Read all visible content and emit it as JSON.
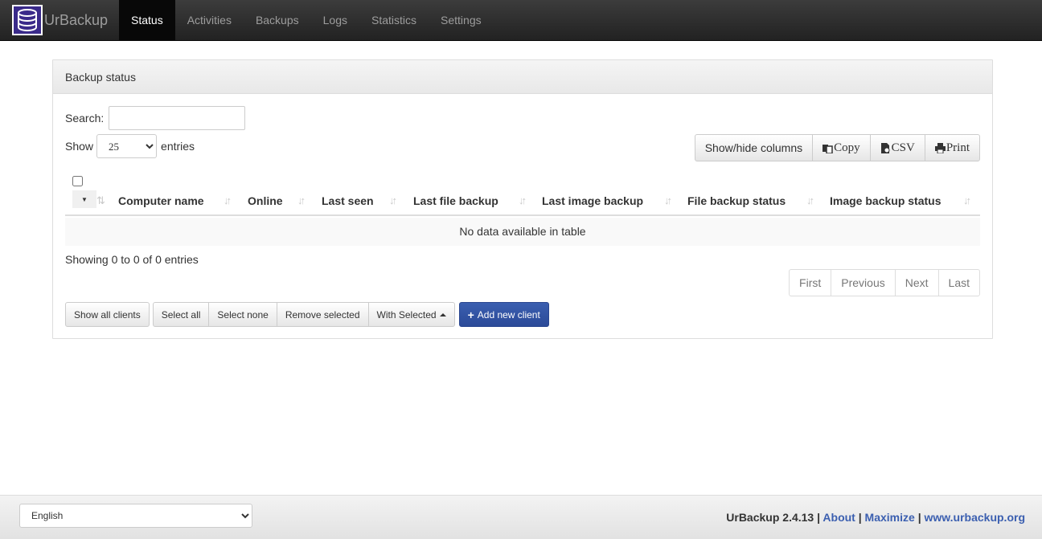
{
  "brand": {
    "name": "UrBackup"
  },
  "nav": {
    "items": [
      {
        "label": "Status",
        "active": true
      },
      {
        "label": "Activities"
      },
      {
        "label": "Backups"
      },
      {
        "label": "Logs"
      },
      {
        "label": "Statistics"
      },
      {
        "label": "Settings"
      }
    ]
  },
  "panel": {
    "title": "Backup status",
    "search_label": "Search:",
    "search_value": "",
    "show_label": "Show",
    "entries_label": "entries",
    "page_length": "25",
    "toolbar": {
      "show_hide": "Show/hide columns",
      "copy": "Copy",
      "csv": "CSV",
      "print": "Print"
    },
    "columns": [
      "Computer name",
      "Online",
      "Last seen",
      "Last file backup",
      "Last image backup",
      "File backup status",
      "Image backup status"
    ],
    "empty_message": "No data available in table",
    "info": "Showing 0 to 0 of 0 entries",
    "pagination": {
      "first": "First",
      "previous": "Previous",
      "next": "Next",
      "last": "Last"
    },
    "actions": {
      "show_all_clients": "Show all clients",
      "select_all": "Select all",
      "select_none": "Select none",
      "remove_selected": "Remove selected",
      "with_selected": "With Selected",
      "add_new_client": "Add new client"
    }
  },
  "footer": {
    "language": "English",
    "version": "UrBackup 2.4.13",
    "sep": "|",
    "about": "About",
    "maximize": "Maximize",
    "website": "www.urbackup.org"
  },
  "colors": {
    "navbar": "#222222",
    "primary": "#3b5fb0",
    "link": "#3b5fb0"
  },
  "icons": {
    "logo": "database-icon",
    "copy": "copy-icon",
    "csv": "csv-file-icon",
    "print": "printer-icon",
    "sort": "sort-arrows-icon",
    "plus": "plus-icon"
  }
}
